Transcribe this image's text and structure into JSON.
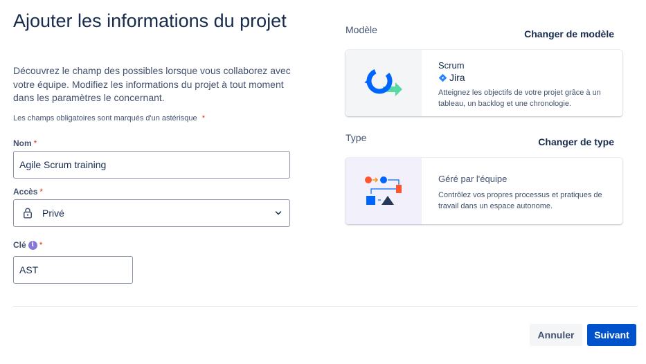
{
  "header": {
    "title": "Ajouter les informations du projet",
    "intro": "Découvrez le champ des possibles lorsque vous collaborez avec votre équipe. Modifiez les informations du projet à tout moment dans les paramètres le concernant.",
    "required_note": "Les champs obligatoires sont marqués d'un astérisque",
    "required_mark": "*"
  },
  "form": {
    "name": {
      "label": "Nom",
      "value": "Agile Scrum training"
    },
    "access": {
      "label": "Accès",
      "value": "Privé",
      "icon": "lock-icon"
    },
    "key": {
      "label": "Clé",
      "value": "AST",
      "info_icon": "i"
    }
  },
  "template": {
    "label": "Modèle",
    "change_link": "Changer de modèle",
    "card": {
      "title": "Scrum",
      "product": "Jira",
      "description": "Atteignez les objectifs de votre projet grâce à un tableau, un backlog et une chronologie."
    }
  },
  "type": {
    "label": "Type",
    "change_link": "Changer de type",
    "card": {
      "title": "Géré par l'équipe",
      "description": "Contrôlez vos propres processus et pratiques de travail dans un espace autonome."
    }
  },
  "footer": {
    "cancel": "Annuler",
    "next": "Suivant"
  },
  "colors": {
    "primary": "#0052cc",
    "required": "#de350b",
    "info": "#8777d9"
  }
}
